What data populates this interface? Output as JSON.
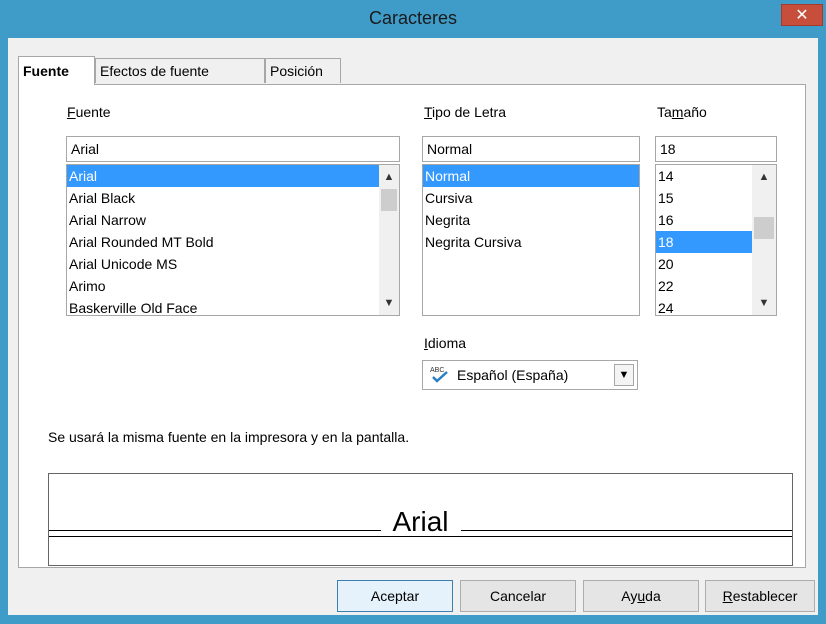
{
  "window": {
    "title": "Caracteres",
    "close_glyph": "✕"
  },
  "tabs": [
    {
      "label": "Fuente",
      "active": true
    },
    {
      "label": "Efectos de fuente",
      "active": false
    },
    {
      "label": "Posición",
      "active": false
    }
  ],
  "font": {
    "label": "Fuente",
    "value": "Arial",
    "items": [
      "Arial",
      "Arial Black",
      "Arial Narrow",
      "Arial Rounded MT Bold",
      "Arial Unicode MS",
      "Arimo",
      "Baskerville Old Face"
    ],
    "selected": "Arial"
  },
  "style": {
    "label": "Tipo de Letra",
    "value": "Normal",
    "items": [
      "Normal",
      "Cursiva",
      "Negrita",
      "Negrita Cursiva"
    ],
    "selected": "Normal"
  },
  "size": {
    "label": "Tamaño",
    "value": "18",
    "items": [
      "14",
      "15",
      "16",
      "18",
      "20",
      "22",
      "24"
    ],
    "selected": "18"
  },
  "language": {
    "label": "Idioma",
    "value": "Español (España)",
    "icon": "spellcheck-icon"
  },
  "info_text": "Se usará la misma fuente en la impresora y en la pantalla.",
  "preview_text": "Arial",
  "buttons": {
    "ok": "Aceptar",
    "cancel": "Cancelar",
    "help": "Ayuda",
    "reset": "Restablecer"
  },
  "colors": {
    "title_bar": "#3f9cc9",
    "selection": "#3399ff",
    "close": "#c74e3a"
  }
}
